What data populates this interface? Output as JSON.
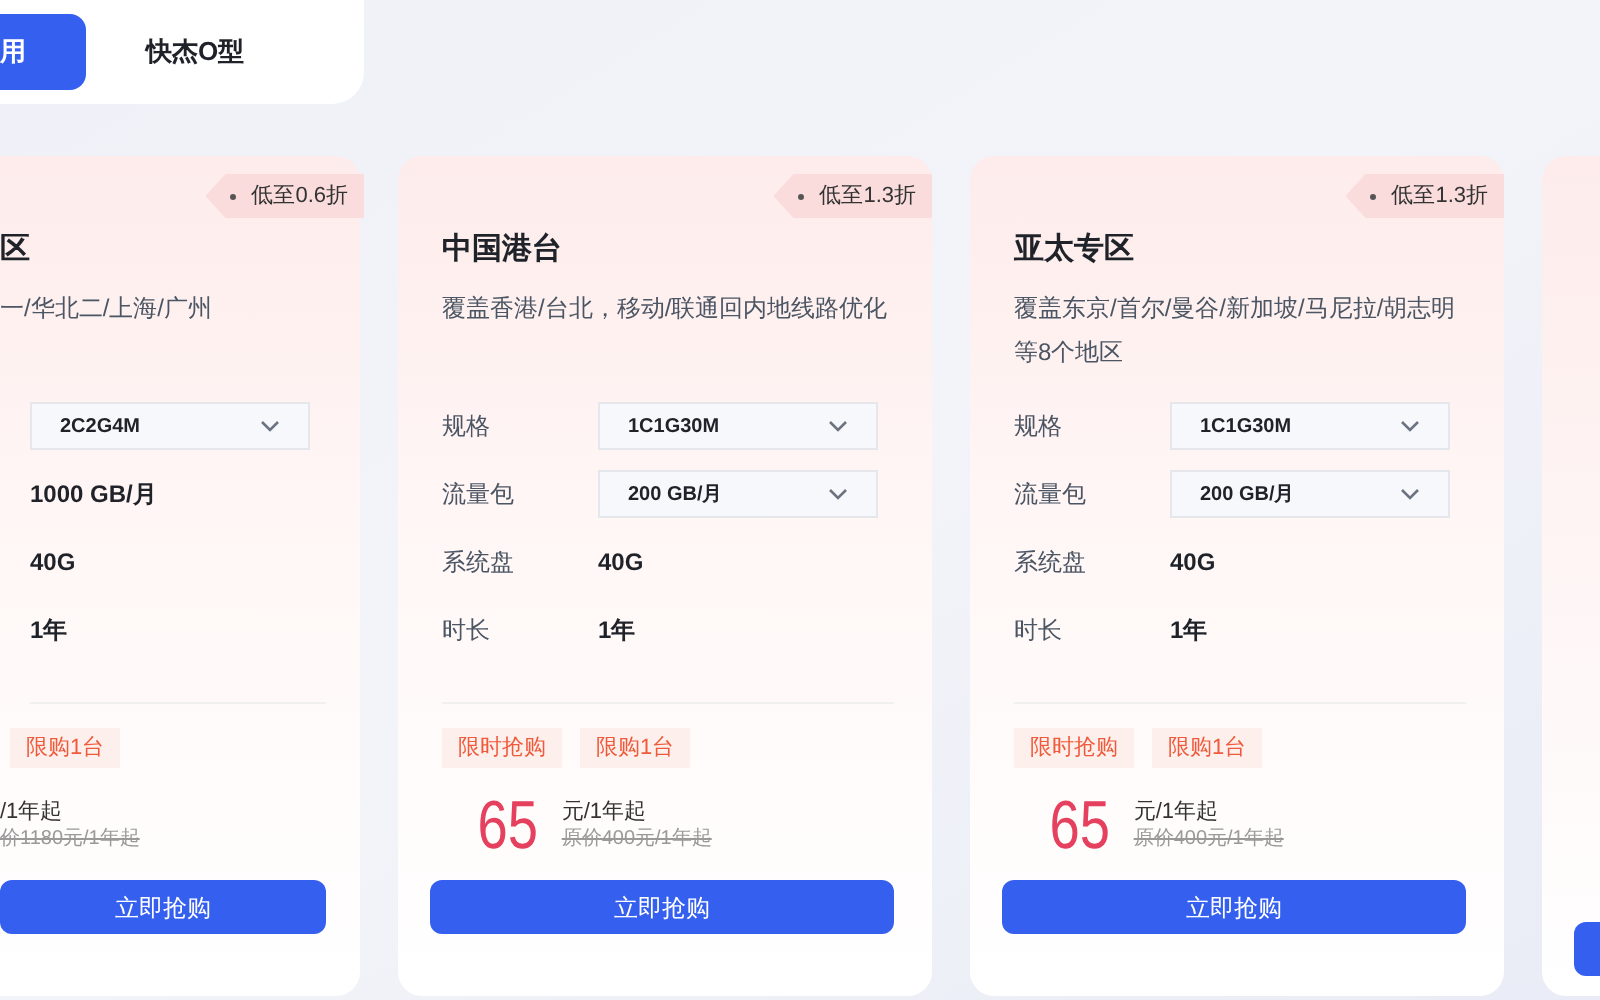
{
  "tabs": [
    {
      "label": "用",
      "selected": true
    },
    {
      "label": "快杰O型",
      "selected": false
    }
  ],
  "cards": [
    {
      "kind": "cut",
      "badge": "低至0.6折",
      "title": "区",
      "description": "一/华北二/上海/广州",
      "specs": [
        {
          "kind": "select",
          "value": "2C2G4M"
        },
        {
          "kind": "text",
          "value": "1000 GB/月"
        },
        {
          "kind": "text",
          "value": "40G"
        },
        {
          "kind": "text",
          "value": "1年"
        }
      ],
      "tags": [
        "限购1台"
      ],
      "price_unit": "/1年起",
      "original_price": "价1180元/1年起",
      "button": "立即抢购"
    },
    {
      "kind": "full",
      "badge": "低至1.3折",
      "title": "中国港台",
      "description": "覆盖香港/台北，移动/联通回内地线路优化",
      "specs": [
        {
          "kind": "select",
          "label": "规格",
          "value": "1C1G30M"
        },
        {
          "kind": "select",
          "label": "流量包",
          "value": "200 GB/月"
        },
        {
          "kind": "text",
          "label": "系统盘",
          "value": "40G"
        },
        {
          "kind": "text",
          "label": "时长",
          "value": "1年"
        }
      ],
      "tags": [
        "限时抢购",
        "限购1台"
      ],
      "price": "65",
      "price_unit": "元/1年起",
      "original_price": "原价400元/1年起",
      "button": "立即抢购"
    },
    {
      "kind": "full",
      "badge": "低至1.3折",
      "title": "亚太专区",
      "description": "覆盖东京/首尔/曼谷/新加坡/马尼拉/胡志明等8个地区",
      "specs": [
        {
          "kind": "select",
          "label": "规格",
          "value": "1C1G30M"
        },
        {
          "kind": "select",
          "label": "流量包",
          "value": "200 GB/月"
        },
        {
          "kind": "text",
          "label": "系统盘",
          "value": "40G"
        },
        {
          "kind": "text",
          "label": "时长",
          "value": "1年"
        }
      ],
      "tags": [
        "限时抢购",
        "限购1台"
      ],
      "price": "65",
      "price_unit": "元/1年起",
      "original_price": "原价400元/1年起",
      "button": "立即抢购"
    }
  ]
}
